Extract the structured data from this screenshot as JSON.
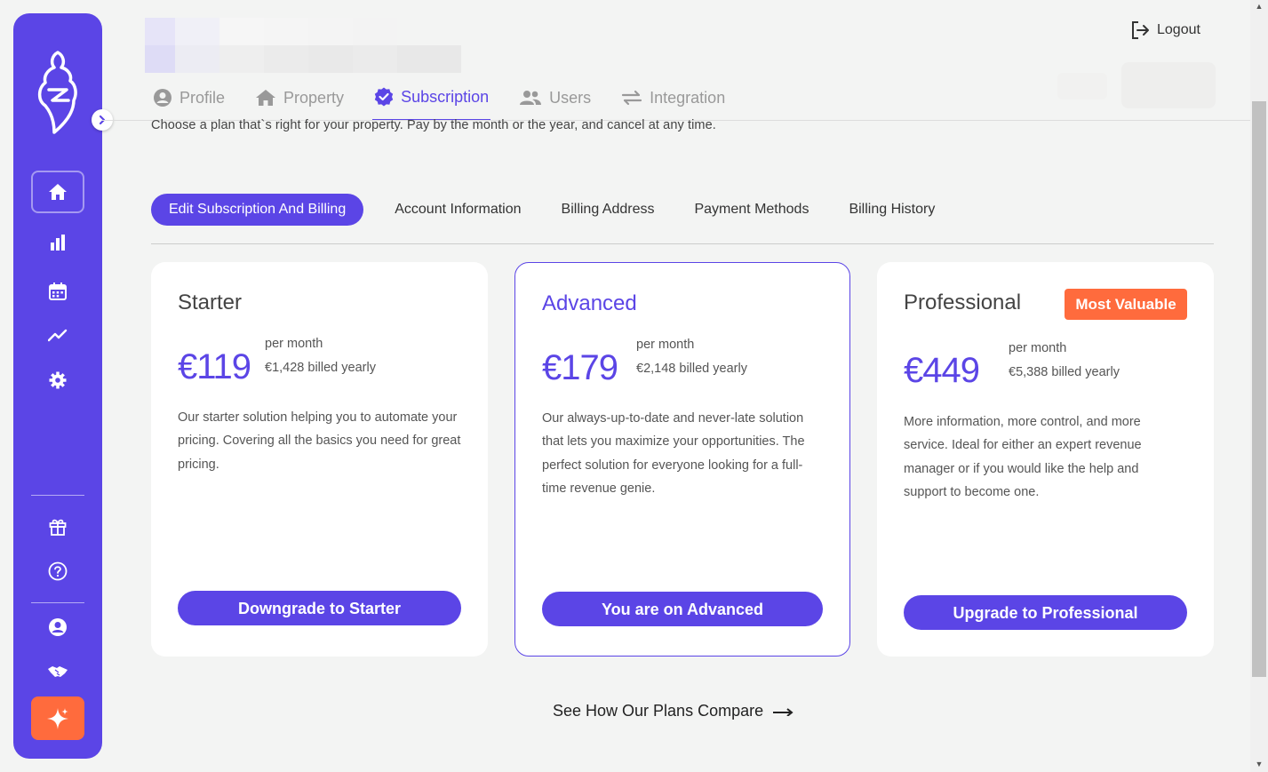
{
  "sidebar": {
    "icons": [
      "logo-icon",
      "home-icon",
      "bar-chart-icon",
      "calendar-icon",
      "trend-line-icon",
      "gear-icon",
      "gift-icon",
      "help-icon",
      "user-account-icon",
      "handshake-icon",
      "sparkle-icon"
    ]
  },
  "header": {
    "logout_label": "Logout",
    "tabs": [
      {
        "label": "Profile",
        "icon": "user-circle-icon"
      },
      {
        "label": "Property",
        "icon": "house-icon"
      },
      {
        "label": "Subscription",
        "icon": "verified-badge-icon",
        "active": true
      },
      {
        "label": "Users",
        "icon": "users-icon"
      },
      {
        "label": "Integration",
        "icon": "swap-arrows-icon"
      }
    ]
  },
  "intro": "Choose a plan that`s right for your property. Pay by the month or the year, and cancel at any time.",
  "subtabs": [
    {
      "label": "Edit Subscription And Billing",
      "active": true
    },
    {
      "label": "Account Information"
    },
    {
      "label": "Billing Address"
    },
    {
      "label": "Payment Methods"
    },
    {
      "label": "Billing History"
    }
  ],
  "plans": [
    {
      "name": "Starter",
      "price": "€119",
      "per_month": "per month",
      "billed": "€1,428 billed yearly",
      "description": "Our starter solution helping you to automate your pricing. Covering all the basics you need for great pricing.",
      "button": "Downgrade to Starter"
    },
    {
      "name": "Advanced",
      "price": "€179",
      "per_month": "per month",
      "billed": "€2,148 billed yearly",
      "description": "Our always-up-to-date and never-late solution that lets you maximize your opportunities. The perfect solution for everyone looking for a full-time revenue genie.",
      "button": "You are on Advanced",
      "current": true
    },
    {
      "name": "Professional",
      "price": "€449",
      "per_month": "per month",
      "billed": "€5,388 billed yearly",
      "description": "More information, more control, and more service. Ideal for either an expert revenue manager or if you would like the help and support to become one.",
      "button": "Upgrade to Professional",
      "badge": "Most Valuable"
    }
  ],
  "compare_link": "See How Our Plans Compare",
  "colors": {
    "accent": "#5b45e6",
    "orange": "#ff6b3d",
    "background": "#f3f4f3"
  }
}
